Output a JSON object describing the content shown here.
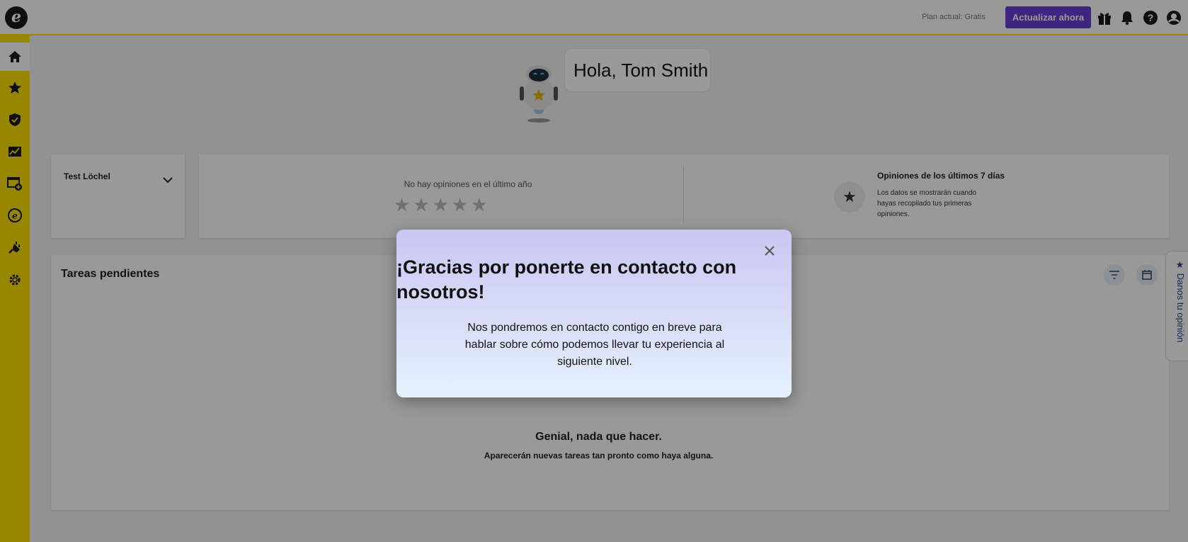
{
  "topbar": {
    "logo": "e",
    "plan_text": "Plan actual: Gratis",
    "upgrade_label": "Actualizar ahora",
    "icons": [
      "gift-icon",
      "bell-icon",
      "help-icon",
      "user-icon"
    ]
  },
  "sidebar": {
    "items": [
      {
        "icon": "home-icon",
        "active": true
      },
      {
        "icon": "star-icon"
      },
      {
        "icon": "shield-check-icon"
      },
      {
        "icon": "chart-icon"
      },
      {
        "icon": "widget-icon"
      },
      {
        "icon": "ekomi-icon"
      },
      {
        "icon": "plug-icon"
      },
      {
        "icon": "gear-icon"
      }
    ]
  },
  "greeting": {
    "text": "Hola, Tom Smith"
  },
  "location": {
    "name": "Test Löchel"
  },
  "ratings": {
    "no_reviews": "No hay opiniones en el último año",
    "stars": "★★★★★",
    "last7_title": "Opiniones de los últimos 7 días",
    "last7_text": "Los datos se mostrarán cuando hayas recopilado tus primeras opiniones."
  },
  "tasks": {
    "title": "Tareas pendientes",
    "empty_title": "Genial, nada que hacer.",
    "empty_subtitle": "Aparecerán nuevas tareas tan pronto como haya alguna."
  },
  "feedback_tab": {
    "label": "★ Danos tu opinión"
  },
  "modal": {
    "title": "¡Gracias por ponerte en contacto con nosotros!",
    "body": "Nos pondremos en contacto contigo en breve para hablar sobre cómo podemos llevar tu experiencia al siguiente nivel.",
    "close": "×"
  },
  "colors": {
    "brand_yellow": "#fce000",
    "upgrade_purple": "#6b3fd6",
    "modal_top": "#c9c7f3",
    "modal_bottom": "#e6f1fd"
  }
}
